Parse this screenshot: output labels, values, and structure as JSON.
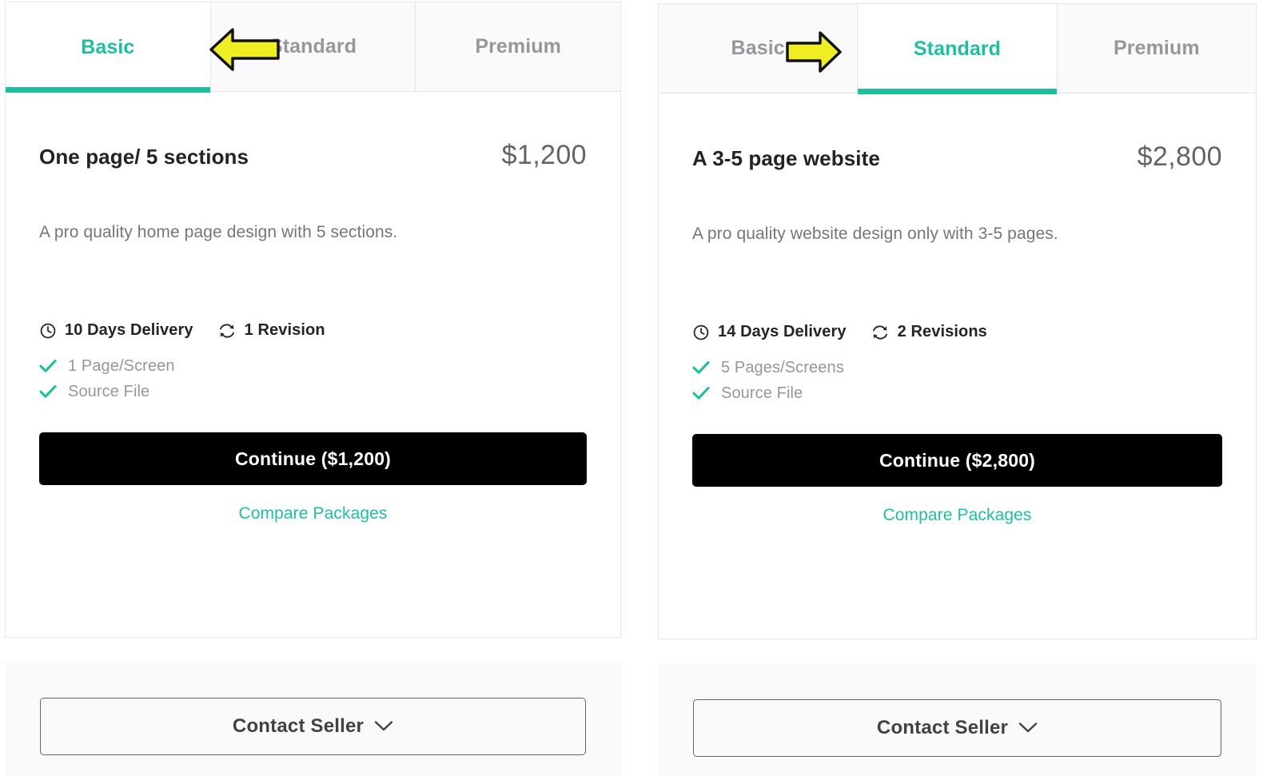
{
  "theme": {
    "accent_teal": "#1dbf9f",
    "button_black": "#000000",
    "panel_gray": "#fafafa",
    "border_gray": "#e4e5e7",
    "muted_text": "#95979d",
    "arrow_yellow": "#eeee22"
  },
  "cards": [
    {
      "id": "left",
      "tabs": [
        {
          "label": "Basic",
          "active": true
        },
        {
          "label": "Standard",
          "active": false
        },
        {
          "label": "Premium",
          "active": false
        }
      ],
      "title": "One page/ 5 sections",
      "price": "$1,200",
      "description": "A pro quality home page design with 5 sections.",
      "delivery": "10 Days Delivery",
      "revisions": "1 Revision",
      "features": [
        "1 Page/Screen",
        "Source File"
      ],
      "continue_label": "Continue ($1,200)",
      "compare_label": "Compare Packages",
      "contact_label": "Contact Seller"
    },
    {
      "id": "right",
      "tabs": [
        {
          "label": "Basic",
          "active": false
        },
        {
          "label": "Standard",
          "active": true
        },
        {
          "label": "Premium",
          "active": false
        }
      ],
      "title": "A 3-5 page website",
      "price": "$2,800",
      "description": "A pro quality website design only with 3-5 pages.",
      "delivery": "14 Days Delivery",
      "revisions": "2 Revisions",
      "features": [
        "5 Pages/Screens",
        "Source File"
      ],
      "continue_label": "Continue ($2,800)",
      "compare_label": "Compare Packages",
      "contact_label": "Contact Seller"
    }
  ],
  "annotations": [
    {
      "icon": "arrow-left-icon",
      "direction": "left",
      "target": "standard-tab-left-card"
    },
    {
      "icon": "arrow-right-icon",
      "direction": "right",
      "target": "standard-tab-right-card"
    }
  ]
}
